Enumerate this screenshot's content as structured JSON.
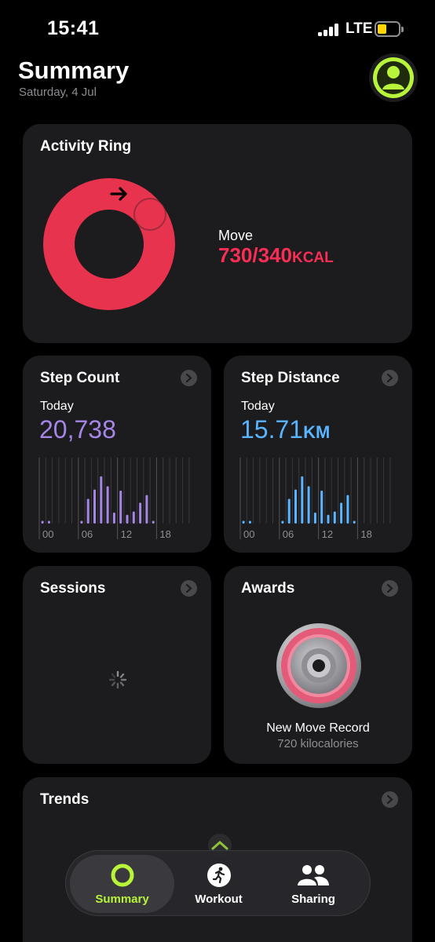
{
  "status": {
    "time": "15:41",
    "network": "LTE"
  },
  "header": {
    "title": "Summary",
    "date": "Saturday, 4 Jul"
  },
  "colors": {
    "move": "#fa2d55",
    "steps": "#a586e6",
    "distance": "#5ab4ff",
    "accent": "#b7f43a",
    "card": "#1c1c1e"
  },
  "activity": {
    "title": "Activity Ring",
    "move_label": "Move",
    "move_value": "730/340",
    "move_unit": "KCAL",
    "move_progress": 2.147
  },
  "steps": {
    "title": "Step Count",
    "today_label": "Today",
    "value": "20,738",
    "tick_labels": [
      "00",
      "06",
      "12",
      "18"
    ],
    "hourly": [
      0.05,
      0.05,
      0,
      0,
      0,
      0,
      0.05,
      0.45,
      0.62,
      0.86,
      0.68,
      0.2,
      0.6,
      0.16,
      0.22,
      0.38,
      0.52,
      0.05,
      0,
      0,
      0,
      0,
      0,
      0
    ]
  },
  "distance": {
    "title": "Step Distance",
    "today_label": "Today",
    "value": "15.71",
    "unit": "KM",
    "tick_labels": [
      "00",
      "06",
      "12",
      "18"
    ],
    "hourly": [
      0.05,
      0.05,
      0,
      0,
      0,
      0,
      0.05,
      0.45,
      0.62,
      0.86,
      0.68,
      0.2,
      0.6,
      0.16,
      0.22,
      0.38,
      0.52,
      0.05,
      0,
      0,
      0,
      0,
      0,
      0
    ]
  },
  "sessions": {
    "title": "Sessions"
  },
  "awards": {
    "title": "Awards",
    "award_title": "New Move Record",
    "award_subtitle": "720 kilocalories"
  },
  "trends": {
    "title": "Trends"
  },
  "tabs": [
    {
      "label": "Summary",
      "icon": "activity-ring-icon",
      "active": true
    },
    {
      "label": "Workout",
      "icon": "running-figure-icon",
      "active": false
    },
    {
      "label": "Sharing",
      "icon": "people-icon",
      "active": false
    }
  ]
}
